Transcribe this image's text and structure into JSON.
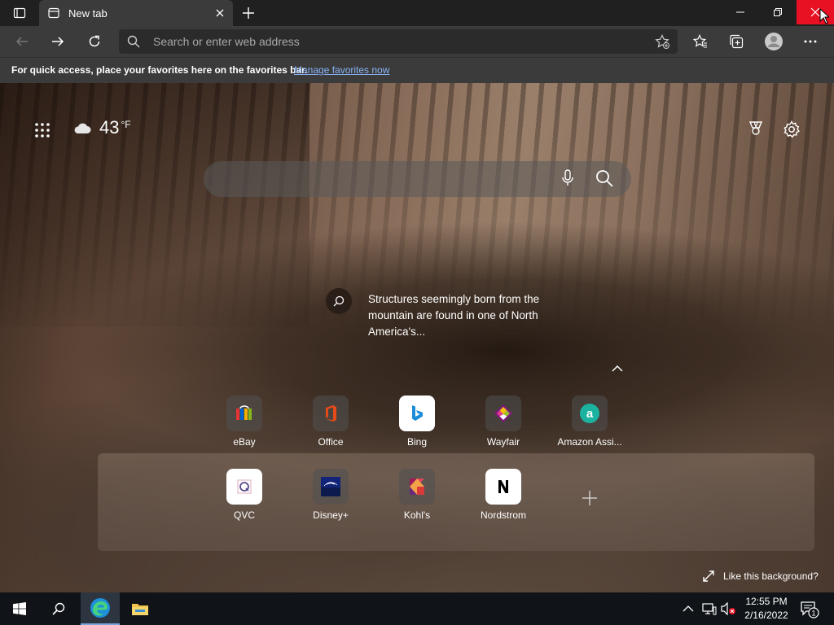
{
  "browser": {
    "tab_title": "New tab",
    "address_placeholder": "Search or enter web address",
    "favorites_bar_text": "For quick access, place your favorites here on the favorites bar.",
    "favorites_bar_link": "Manage favorites now"
  },
  "newtab": {
    "weather": {
      "temp": "43",
      "unit": "°F"
    },
    "caption": "Structures seemingly born from the mountain are found in one of North America's...",
    "like_background": "Like this background?",
    "quick_links": [
      {
        "label": "eBay",
        "icon": "ebay-icon"
      },
      {
        "label": "Office",
        "icon": "office-icon"
      },
      {
        "label": "Bing",
        "icon": "bing-icon"
      },
      {
        "label": "Wayfair",
        "icon": "wayfair-icon"
      },
      {
        "label": "Amazon Assi...",
        "icon": "amazon-assistant-icon"
      },
      {
        "label": "QVC",
        "icon": "qvc-icon"
      },
      {
        "label": "Disney+",
        "icon": "disney-plus-icon"
      },
      {
        "label": "Kohl's",
        "icon": "kohls-icon"
      },
      {
        "label": "Nordstrom",
        "icon": "nordstrom-icon"
      }
    ]
  },
  "taskbar": {
    "time": "12:55 PM",
    "date": "2/16/2022",
    "notification_count": "1"
  },
  "colors": {
    "close_red": "#e81123",
    "link_blue": "#8ab4f8",
    "chrome_dark": "#202020",
    "toolbar": "#3b3b3b"
  }
}
